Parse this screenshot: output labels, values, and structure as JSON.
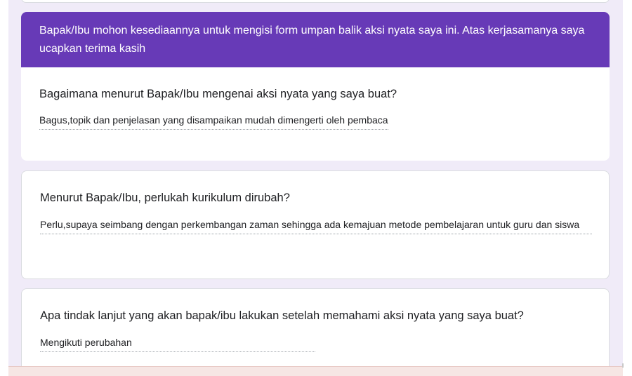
{
  "header": {
    "description": "Bapak/Ibu mohon kesediaannya untuk mengisi form umpan balik aksi nyata saya ini. Atas kerjasamanya saya ucapkan terima kasih"
  },
  "questions": [
    {
      "question": "Bagaimana menurut Bapak/Ibu mengenai aksi nyata yang saya buat?",
      "answer": "Bagus,topik dan penjelasan yang disampaikan mudah dimengerti oleh pembaca"
    },
    {
      "question": "Menurut Bapak/Ibu, perlukah kurikulum dirubah?",
      "answer": "Perlu,supaya seimbang dengan perkembangan zaman sehingga ada kemajuan metode pembelajaran untuk guru dan siswa"
    },
    {
      "question": "Apa tindak lanjut yang akan bapak/ibu lakukan setelah memahami aksi nyata yang saya buat?",
      "answer": "Mengikuti perubahan"
    }
  ],
  "theme": {
    "accent": "#673ab7",
    "background": "#f0ebf8"
  }
}
